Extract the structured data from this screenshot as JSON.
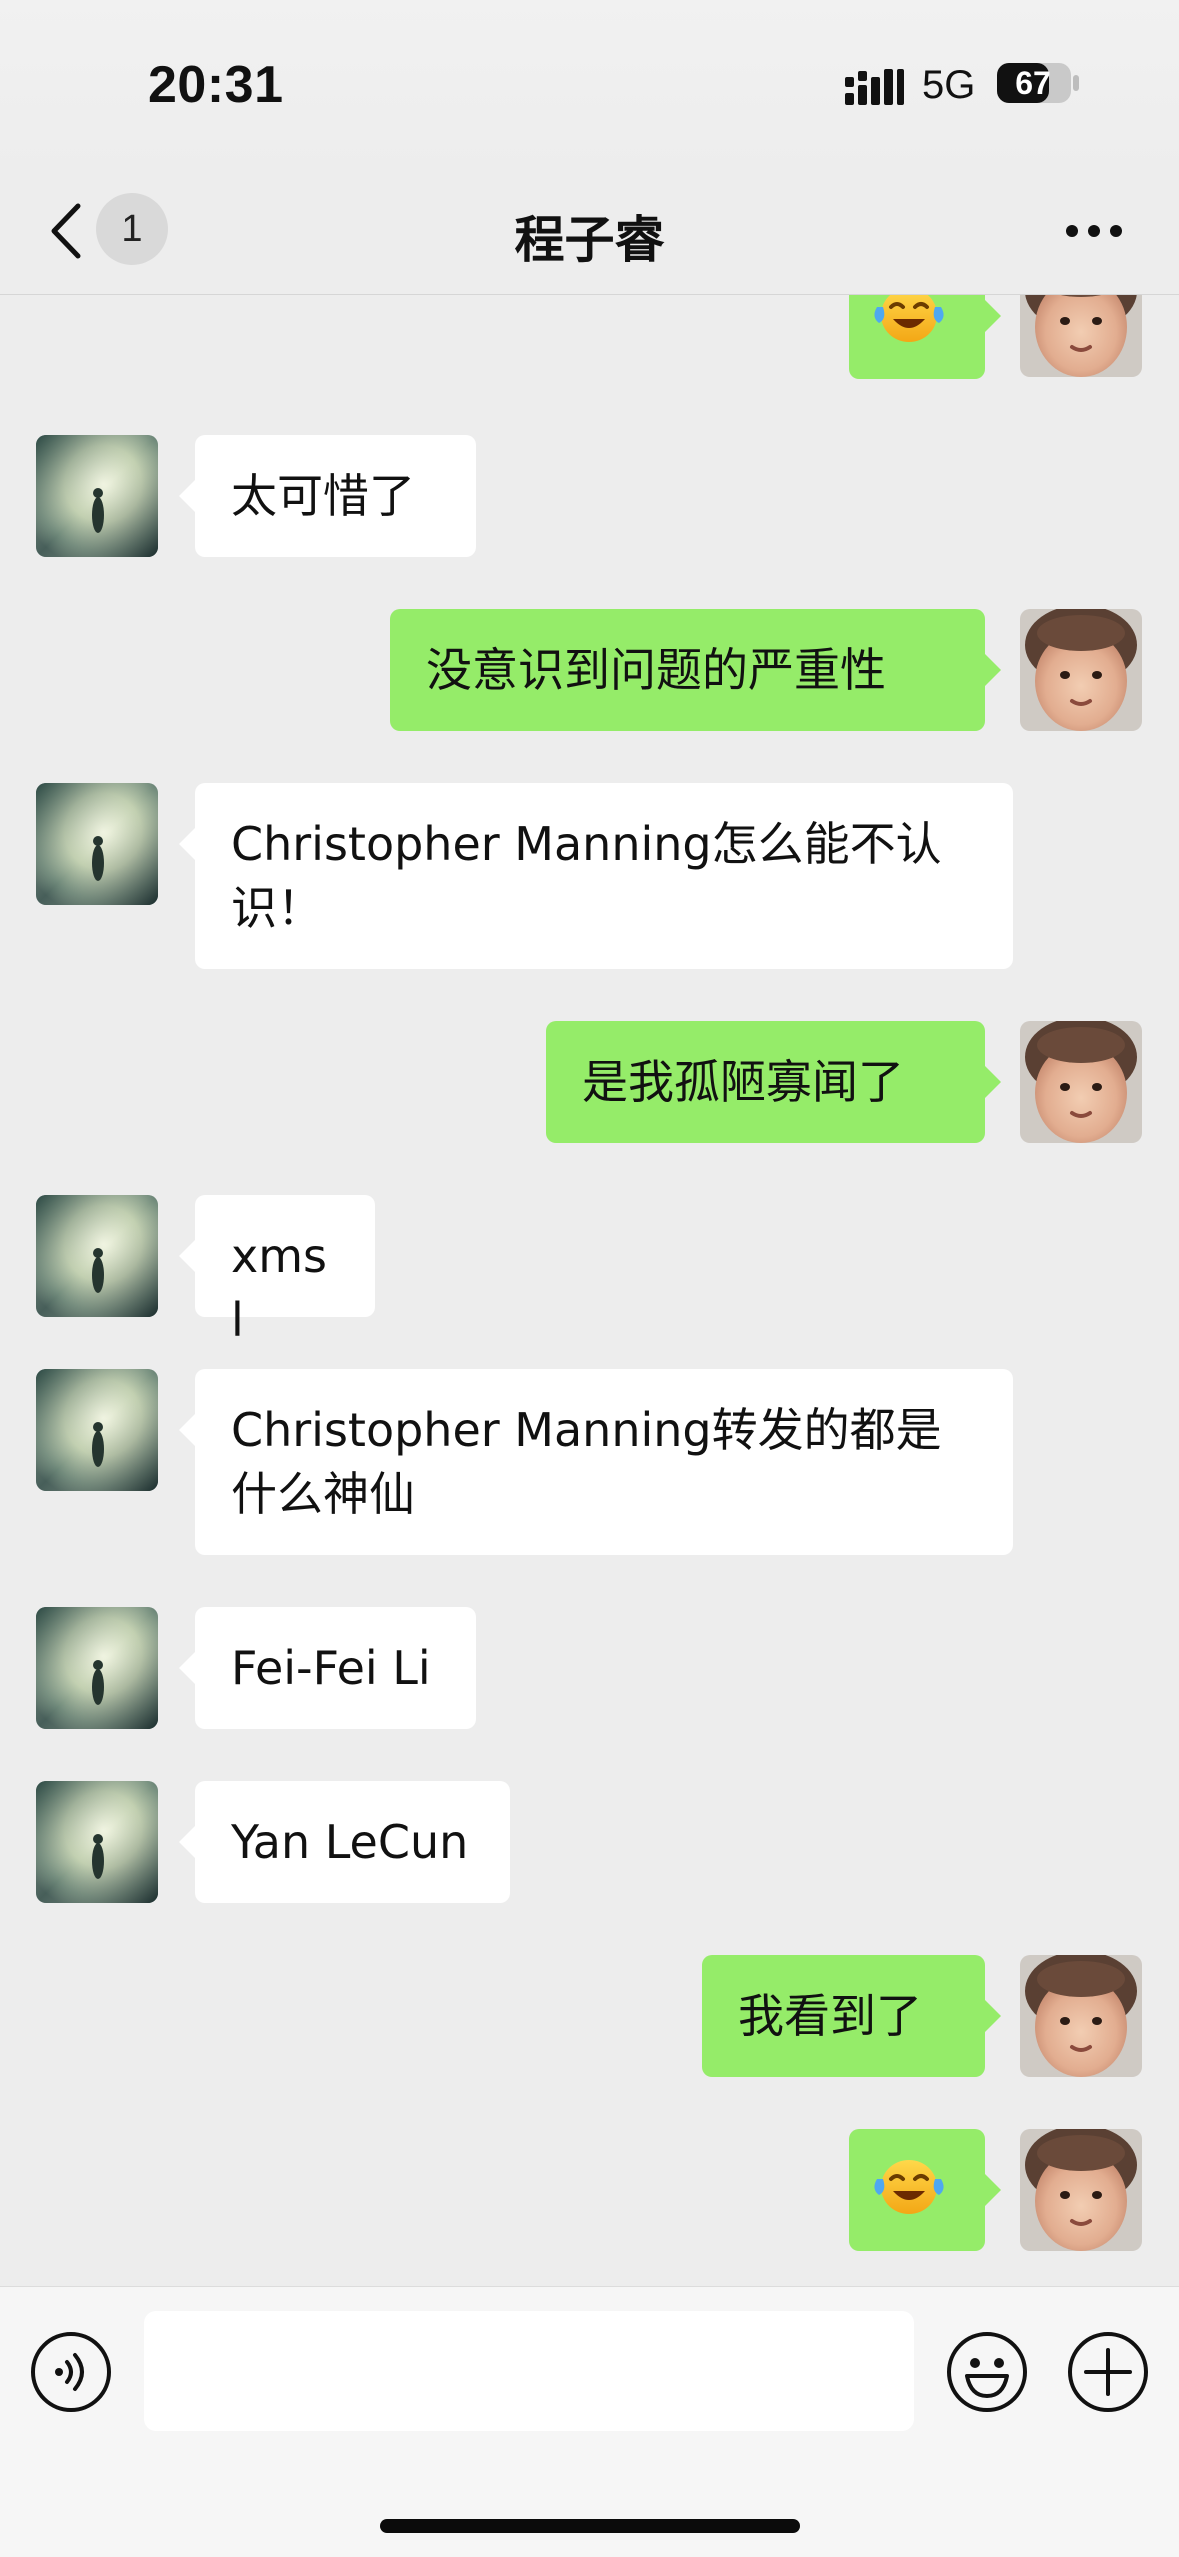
{
  "status_bar": {
    "time": "20:31",
    "network": "5G",
    "battery": "67"
  },
  "nav": {
    "unread_count": "1",
    "title": "程子睿"
  },
  "icons": {
    "back": "chevron-left-icon",
    "more": "ellipsis-icon",
    "voice": "voice-icon",
    "emoji": "smiley-face-icon",
    "plus": "plus-icon",
    "sticker": "tears-of-joy-emoji"
  },
  "colors": {
    "background": "#ededed",
    "outgoing_bubble": "#95ec69",
    "incoming_bubble": "#ffffff"
  },
  "messages": [
    {
      "side": "out",
      "type": "emoji",
      "text": ""
    },
    {
      "side": "in",
      "type": "text",
      "text": "太可惜了"
    },
    {
      "side": "out",
      "type": "text",
      "text": "没意识到问题的严重性"
    },
    {
      "side": "in",
      "type": "text",
      "text": "Christopher Manning怎么能不认识！"
    },
    {
      "side": "out",
      "type": "text",
      "text": "是我孤陋寡闻了"
    },
    {
      "side": "in",
      "type": "text",
      "text": "xmsl"
    },
    {
      "side": "in",
      "type": "text",
      "text": "Christopher Manning转发的都是什么神仙"
    },
    {
      "side": "in",
      "type": "text",
      "text": "Fei-Fei Li"
    },
    {
      "side": "in",
      "type": "text",
      "text": "Yan LeCun"
    },
    {
      "side": "out",
      "type": "text",
      "text": "我看到了"
    },
    {
      "side": "out",
      "type": "emoji",
      "text": ""
    }
  ],
  "input": {
    "value": "",
    "placeholder": ""
  }
}
